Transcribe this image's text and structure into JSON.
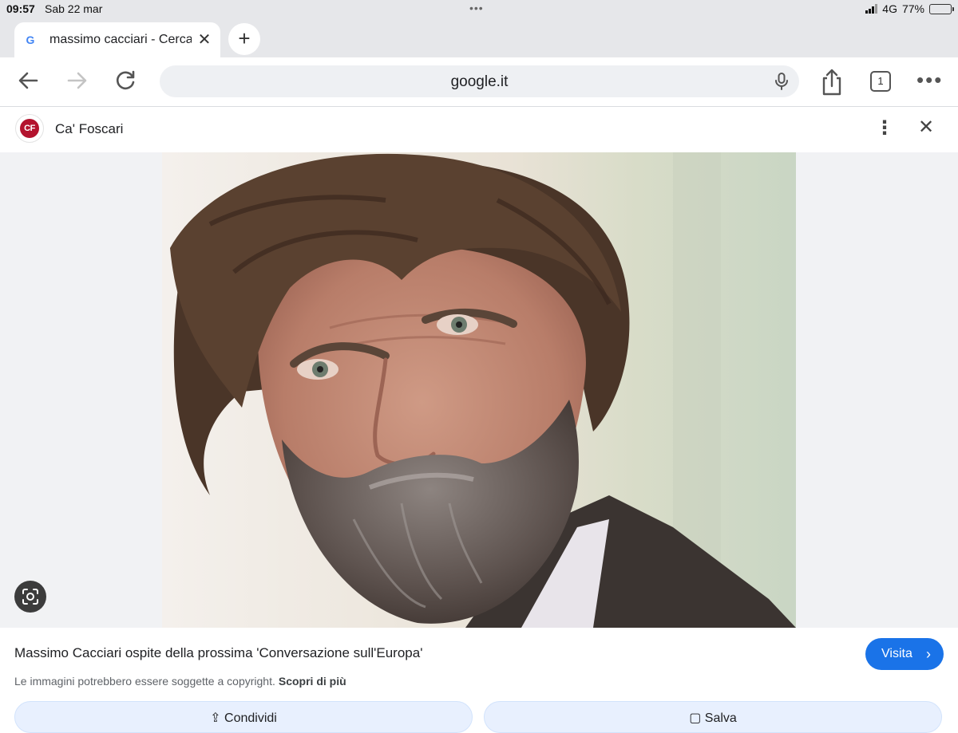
{
  "status_bar": {
    "time": "09:57",
    "date": "Sab 22 mar",
    "network": "4G",
    "battery": "77%",
    "battery_level": 0.77
  },
  "tab": {
    "title": "massimo cacciari - Cerca",
    "favicon": "google-favicon"
  },
  "toolbar": {
    "url": "google.it",
    "tab_count": "1"
  },
  "source": {
    "logo_text": "CF",
    "name": "Ca' Foscari"
  },
  "result": {
    "title": "Massimo Cacciari ospite della prossima 'Conversazione sull'Europa'",
    "visit_label": "Visita",
    "copyright_text": "Le immagini potrebbero essere soggette a copyright.",
    "learn_more_label": "Scopri di più"
  },
  "actions": {
    "share_label": "Condividi",
    "save_label": "Salva"
  },
  "colors": {
    "accent": "#1a73e8",
    "source_logo": "#b3132e",
    "chrome_bg": "#e6e7ea"
  }
}
